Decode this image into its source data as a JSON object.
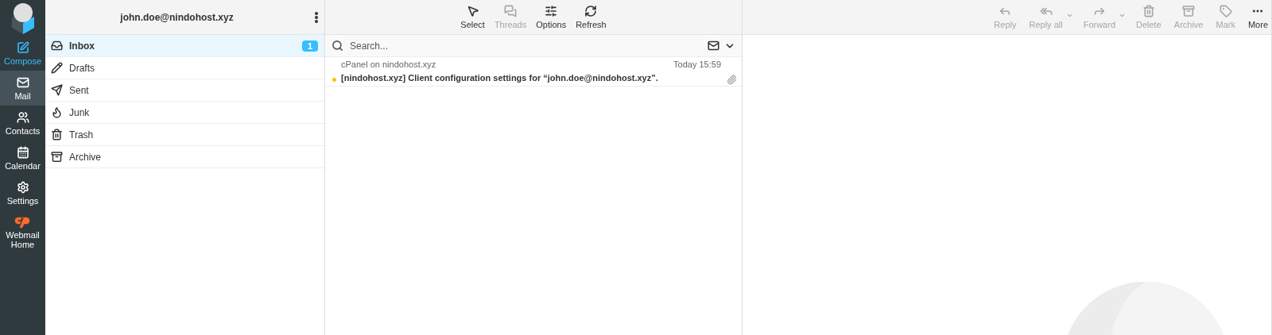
{
  "nav": [
    {
      "label": "Compose",
      "kind": "action",
      "selected": false
    },
    {
      "label": "Mail",
      "kind": "nav",
      "selected": true
    },
    {
      "label": "Contacts",
      "kind": "nav",
      "selected": false
    },
    {
      "label": "Calendar",
      "kind": "nav",
      "selected": false
    },
    {
      "label": "Settings",
      "kind": "nav",
      "selected": false
    },
    {
      "label": "Webmail Home",
      "kind": "brand",
      "selected": false
    }
  ],
  "account": {
    "title": "john.doe@nindohost.xyz"
  },
  "folders": [
    {
      "name": "Inbox",
      "selected": true,
      "count": "1"
    },
    {
      "name": "Drafts",
      "selected": false
    },
    {
      "name": "Sent",
      "selected": false
    },
    {
      "name": "Junk",
      "selected": false
    },
    {
      "name": "Trash",
      "selected": false
    },
    {
      "name": "Archive",
      "selected": false
    }
  ],
  "list_toolbar": [
    {
      "label": "Select",
      "disabled": false
    },
    {
      "label": "Threads",
      "disabled": true
    },
    {
      "label": "Options",
      "disabled": false
    },
    {
      "label": "Refresh",
      "disabled": false
    }
  ],
  "search": {
    "placeholder": "Search..."
  },
  "messages": [
    {
      "from": "cPanel on nindohost.xyz",
      "date": "Today 15:59",
      "subject": "[nindohost.xyz] Client configuration settings for “john.doe@nindohost.xyz”.",
      "unread": true,
      "attachment": true
    }
  ],
  "preview_toolbar": [
    {
      "label": "Reply",
      "disabled": true,
      "dropdown": false
    },
    {
      "label": "Reply all",
      "disabled": true,
      "dropdown": true
    },
    {
      "label": "Forward",
      "disabled": true,
      "dropdown": true
    },
    {
      "label": "Delete",
      "disabled": true,
      "dropdown": false
    },
    {
      "label": "Archive",
      "disabled": true,
      "dropdown": false
    },
    {
      "label": "Mark",
      "disabled": true,
      "dropdown": false
    },
    {
      "label": "More",
      "disabled": false,
      "dropdown": false
    }
  ]
}
